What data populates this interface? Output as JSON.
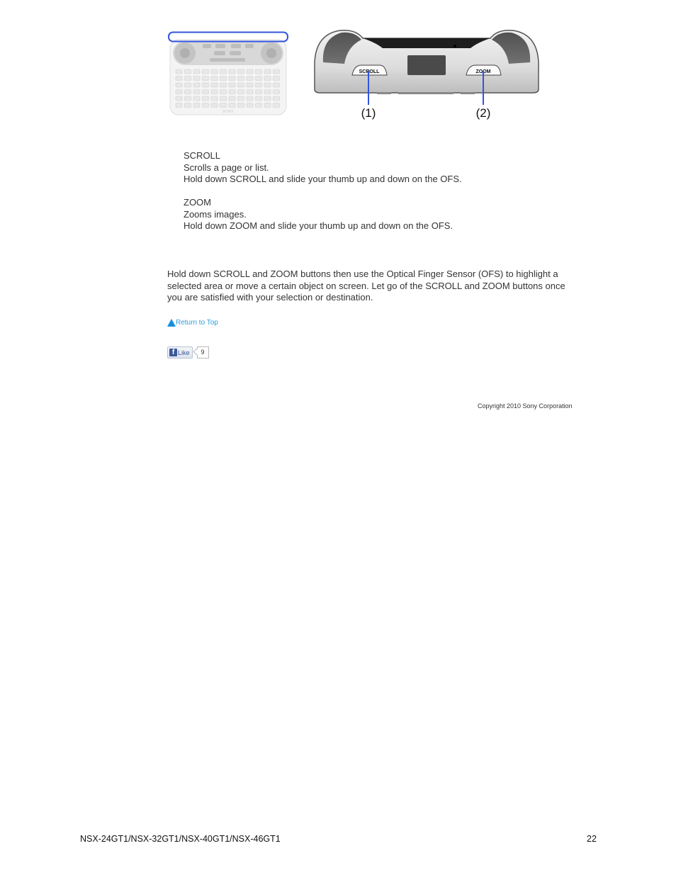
{
  "figure": {
    "device_buttons": [
      "SCROLL",
      "ZOOM"
    ],
    "callouts": [
      "(1)",
      "(2)"
    ],
    "remote_brand": "SONY",
    "highlight_color": "#3355dd",
    "callout_line_color": "#3355dd"
  },
  "items": [
    {
      "title": "SCROLL",
      "lines": [
        "Scrolls a page or list.",
        "Hold down SCROLL and slide your thumb up and down on the OFS."
      ]
    },
    {
      "title": "ZOOM",
      "lines": [
        "Zooms images.",
        "Hold down ZOOM and slide your thumb up and down on the OFS."
      ]
    }
  ],
  "paragraph": "Hold down SCROLL and ZOOM buttons then use the Optical Finger Sensor (OFS) to highlight a selected area or move a certain object on screen. Let go of the SCROLL and ZOOM buttons once you are satisfied with your selection or destination.",
  "return_to_top": {
    "label": "Return to Top",
    "icon": "triangle-up-icon",
    "color": "#2b9fdb"
  },
  "like": {
    "label": "Like",
    "count": "9",
    "icon": "facebook-icon"
  },
  "copyright": "Copyright 2010 Sony Corporation",
  "footer": {
    "models": "NSX-24GT1/NSX-32GT1/NSX-40GT1/NSX-46GT1",
    "page": "22"
  }
}
